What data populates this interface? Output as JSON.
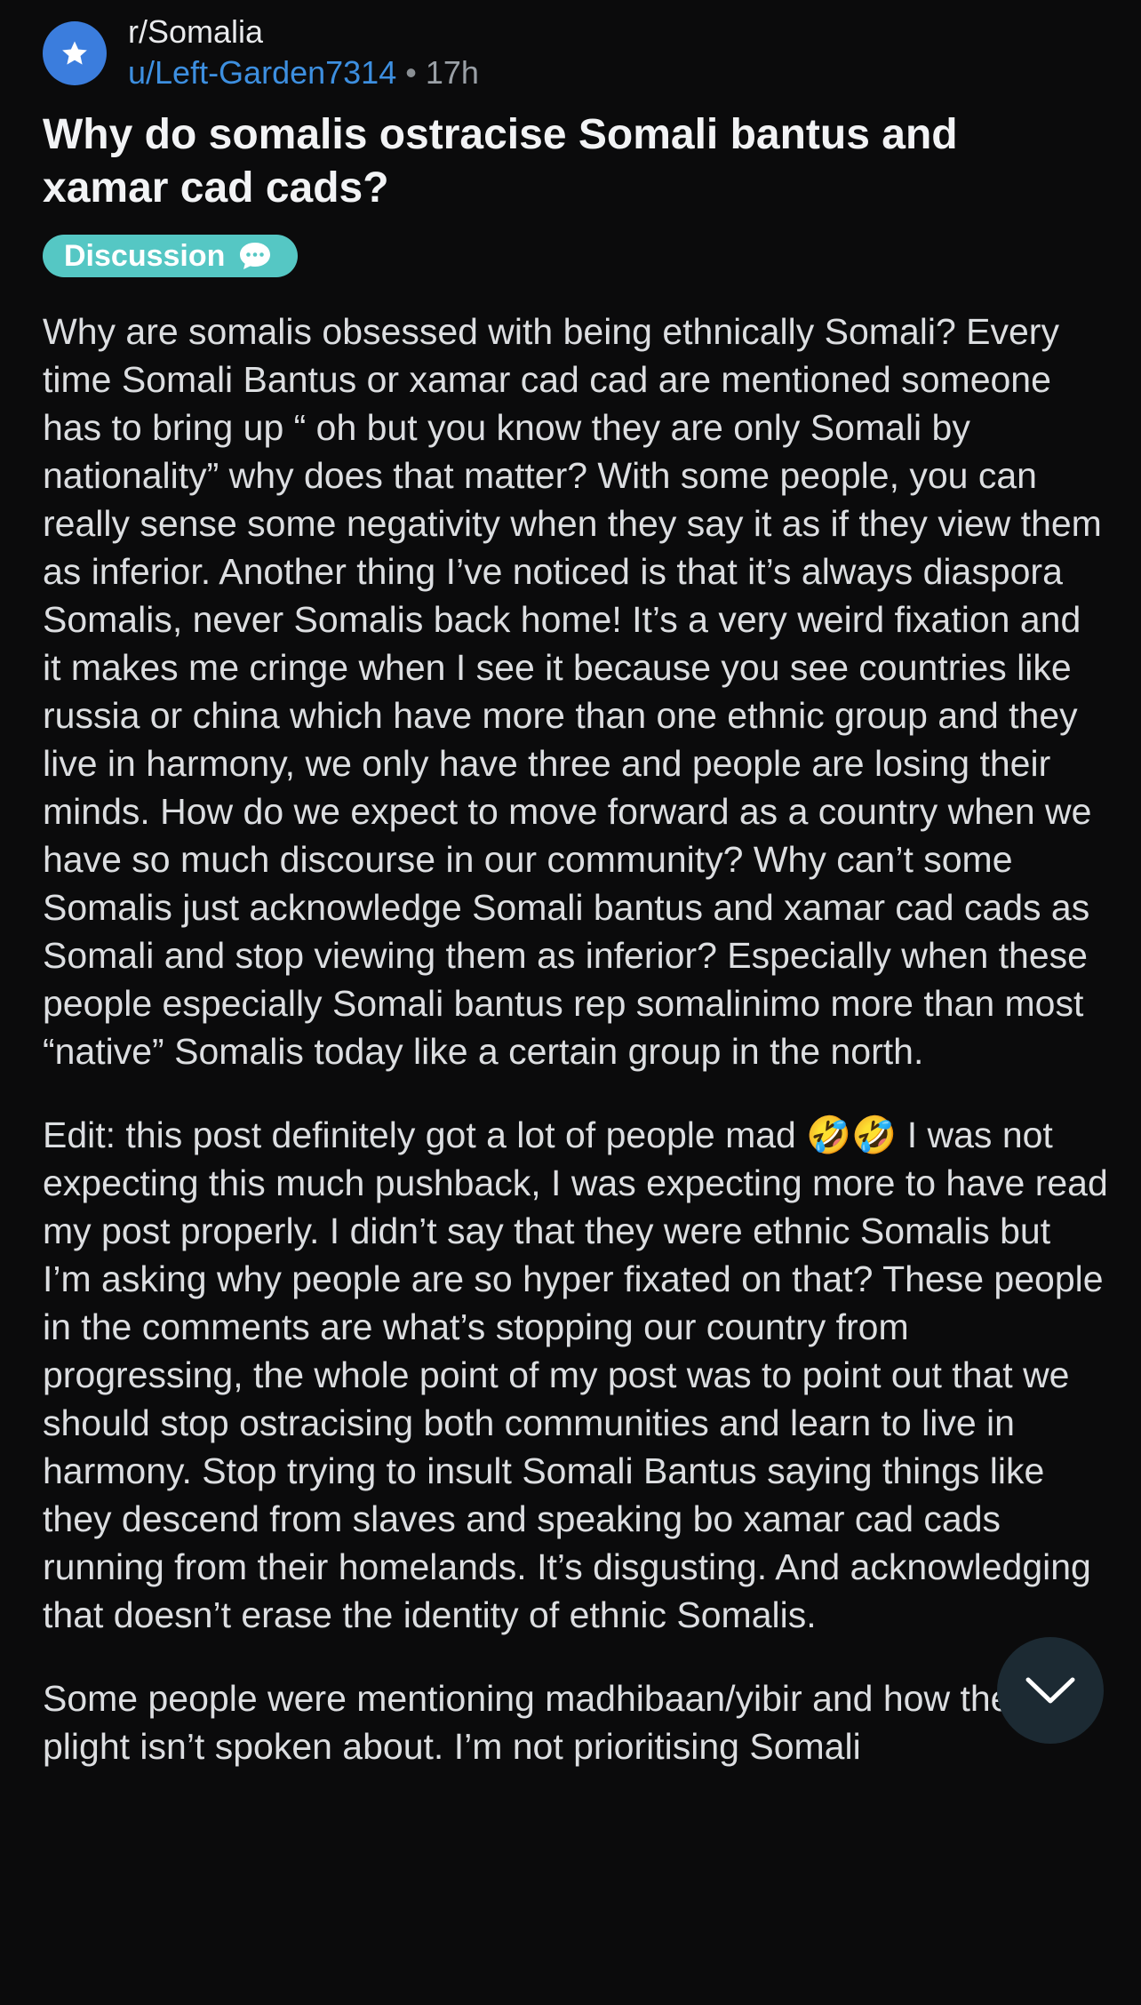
{
  "post": {
    "subreddit": "r/Somalia",
    "author": "u/Left-Garden7314",
    "separator": "•",
    "time": "17h",
    "title": "Why do somalis ostracise Somali bantus and xamar cad cads?",
    "flair": {
      "label": "Discussion",
      "icon": "speech-bubble-icon",
      "color": "#55c7c4"
    },
    "paragraphs": [
      "Why are somalis obsessed with being ethnically Somali? Every time Somali Bantus or xamar cad cad are mentioned someone has to bring up “ oh but you know they are only Somali by nationality” why does that matter? With some people, you can really sense some negativity when they say it as if they view them as inferior. Another thing I’ve noticed is that it’s always diaspora Somalis, never Somalis back home! It’s a very weird fixation and it makes me cringe when I see it because you see countries like russia or china which have more than one ethnic group and they live in harmony, we only have three and people are losing their minds. How do we expect to move forward as a country when we have so much discourse in our community? Why can’t some Somalis just acknowledge Somali bantus and xamar cad cads as Somali and stop viewing them as inferior? Especially when these people especially Somali bantus rep somalinimo more than most “native” Somalis today like a certain group in the north.",
      "Edit: this post definitely got a lot of people mad 🤣🤣 I was not expecting this much pushback, I was expecting more to have read my post properly. I didn’t say that they were ethnic Somalis but I’m asking why people are so hyper fixated on that? These people in the comments are what’s stopping our country from progressing, the whole point of my post was to point out that we should stop ostracising both communities and learn to live in harmony. Stop trying to insult Somali Bantus saying things like they descend from slaves and speaking bo xamar cad cads running from their homelands. It’s disgusting. And acknowledging that doesn’t erase the identity of ethnic Somalis.",
      "Some people were mentioning madhibaan/yibir and how their plight isn’t spoken about. I’m not prioritising Somali"
    ]
  },
  "controls": {
    "scroll_down_icon": "chevron-down-icon"
  },
  "colors": {
    "background": "#0b0b0c",
    "username": "#3d8fe0",
    "avatar": "#3b7ddd",
    "scroll_button": "#1c2a33"
  }
}
